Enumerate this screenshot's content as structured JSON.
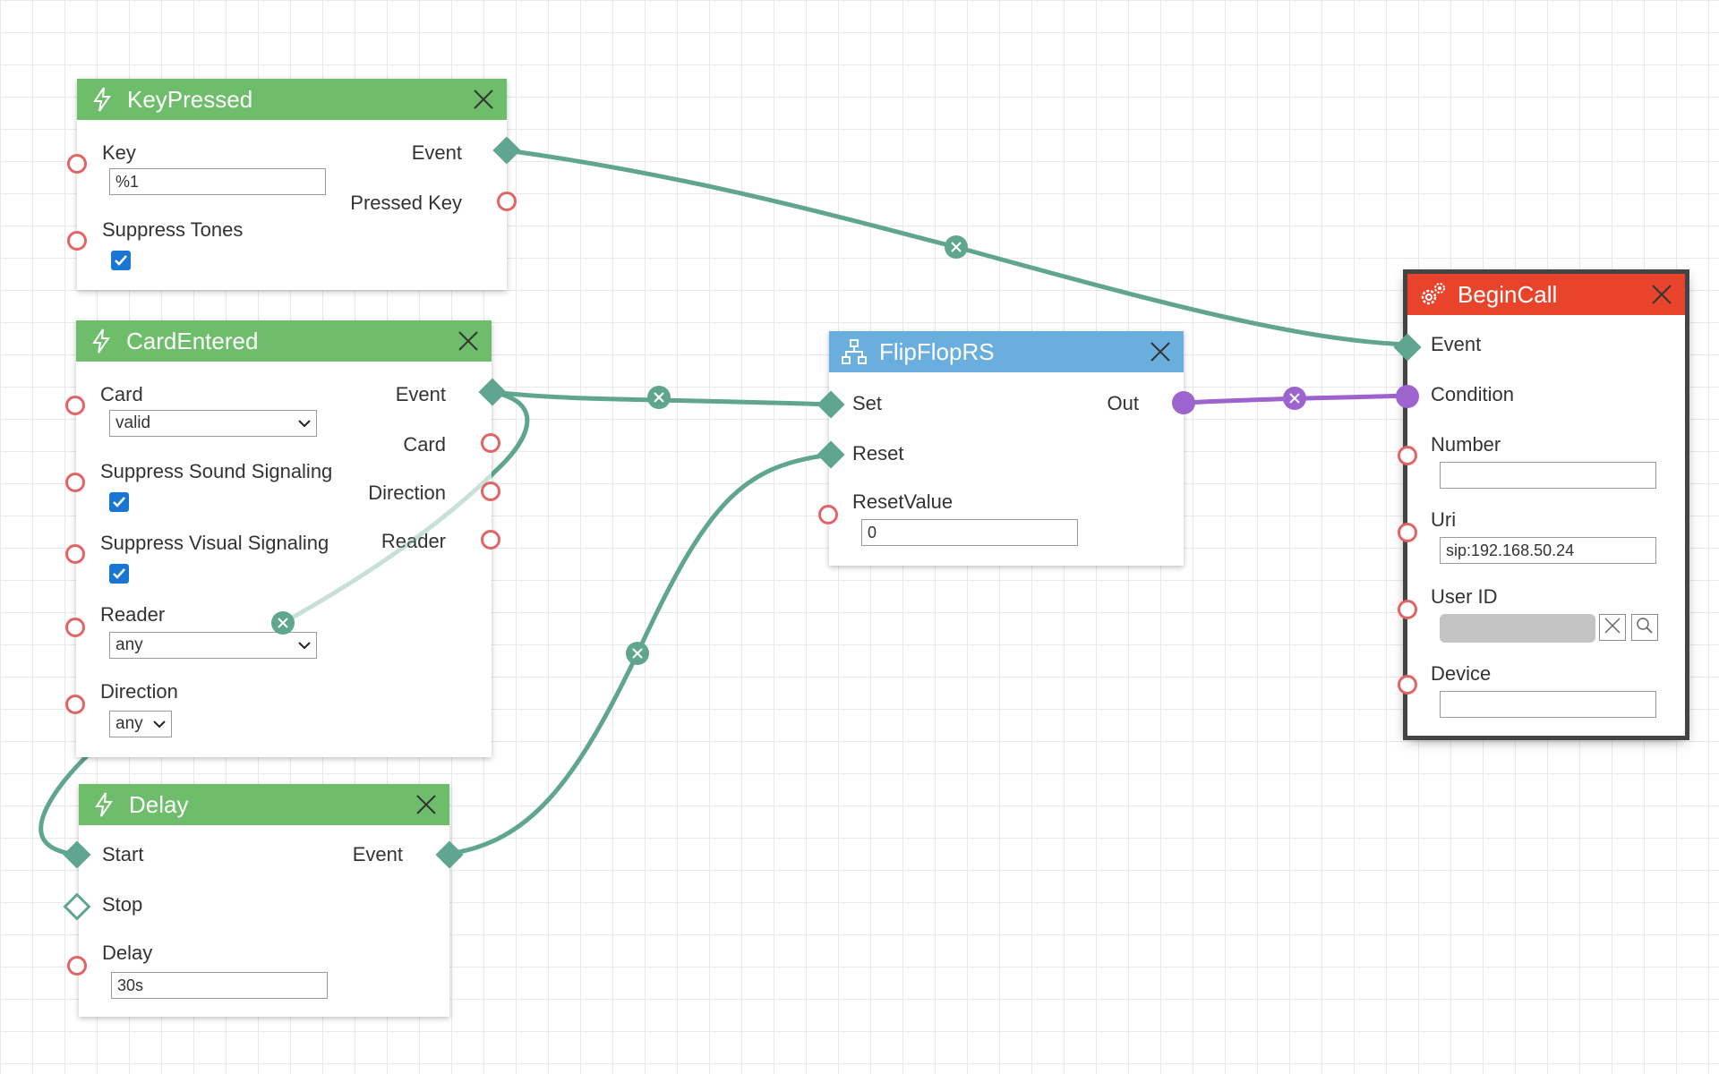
{
  "colors": {
    "event_green": "#6ebd6b",
    "logic_blue": "#6aaede",
    "action_red": "#e8442c",
    "wire_teal": "#5fa58f",
    "wire_purple": "#9d63cf",
    "port_red": "#e46464",
    "checkbox_blue": "#1976d2"
  },
  "key_pressed": {
    "title": "KeyPressed",
    "icon": "lightning-icon",
    "inputs": {
      "key": "Key",
      "suppress_tones": "Suppress Tones"
    },
    "outputs": {
      "event": "Event",
      "pressed_key": "Pressed Key"
    },
    "key_value": "%1",
    "suppress_tones_checked": true
  },
  "card_entered": {
    "title": "CardEntered",
    "icon": "lightning-icon",
    "inputs": {
      "card": "Card",
      "suppress_sound": "Suppress Sound Signaling",
      "suppress_visual": "Suppress Visual Signaling",
      "reader": "Reader",
      "direction": "Direction"
    },
    "outputs": {
      "event": "Event",
      "card": "Card",
      "direction": "Direction",
      "reader": "Reader"
    },
    "card_value": "valid",
    "reader_value": "any",
    "direction_value": "any",
    "suppress_sound_checked": true,
    "suppress_visual_checked": true
  },
  "delay": {
    "title": "Delay",
    "icon": "lightning-icon",
    "inputs": {
      "start": "Start",
      "stop": "Stop",
      "delay": "Delay"
    },
    "outputs": {
      "event": "Event"
    },
    "delay_value": "30s"
  },
  "flipflop": {
    "title": "FlipFlopRS",
    "icon": "hierarchy-icon",
    "inputs": {
      "set": "Set",
      "reset": "Reset",
      "reset_value": "ResetValue"
    },
    "outputs": {
      "out": "Out"
    },
    "reset_value": "0"
  },
  "begin_call": {
    "title": "BeginCall",
    "icon": "gears-icon",
    "inputs": {
      "event": "Event",
      "condition": "Condition",
      "number": "Number",
      "uri": "Uri",
      "user_id": "User ID",
      "device": "Device"
    },
    "number_value": "",
    "uri_value": "sip:192.168.50.24",
    "device_value": ""
  }
}
